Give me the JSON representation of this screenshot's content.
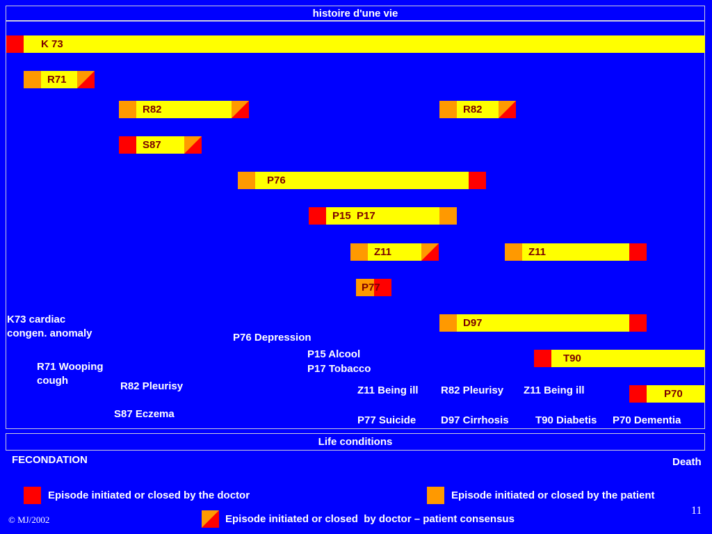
{
  "title": "histoire d'une vie",
  "life_conditions": "Life conditions",
  "fecondation": "FECONDATION",
  "death": "Death",
  "bars": {
    "k73": "K 73",
    "r71": "R71",
    "r82a": "R82",
    "r82b": "R82",
    "s87": "S87",
    "p76": "P76",
    "p15p17": "P15  P17",
    "z11a": "Z11",
    "z11b": "Z11",
    "p77": "P77",
    "d97": "D97",
    "t90": "T90",
    "p70": "P70"
  },
  "descriptions": {
    "k73_line1": "K73 cardiac",
    "k73_line2": "congen. anomaly",
    "r71_line1": "R71 Wooping",
    "r71_line2": "cough",
    "r82": "R82 Pleurisy",
    "s87": "S87 Eczema",
    "p76": "P76 Depression",
    "p15": "P15 Alcool",
    "p17": "P17 Tobacco",
    "z11a": "Z11 Being ill",
    "r82b": "R82 Pleurisy",
    "z11b": "Z11 Being ill",
    "p77": "P77 Suicide",
    "d97": "D97 Cirrhosis",
    "t90": "T90 Diabetis",
    "p70": "P70 Dementia"
  },
  "legend": {
    "doctor": "Episode initiated or closed by the doctor",
    "patient": "Episode initiated or closed by the patient",
    "consensus": "Episode initiated or closed  by doctor – patient consensus"
  },
  "colors": {
    "background": "#0000ff",
    "episode": "#ffff00",
    "doctor": "#ff0000",
    "patient": "#ff9900"
  },
  "footer": {
    "copyright": "© MJ/2002",
    "page_number": "11"
  }
}
